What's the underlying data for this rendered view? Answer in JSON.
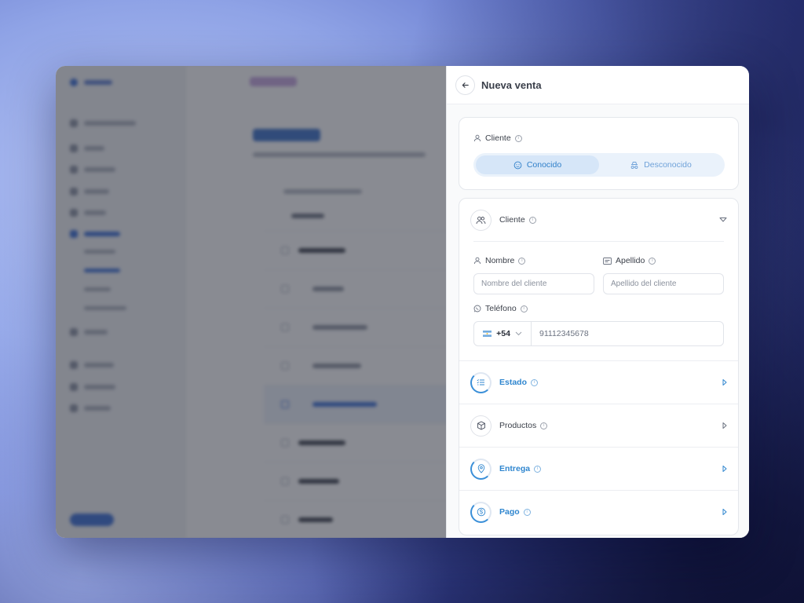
{
  "panel": {
    "title": "Nueva venta",
    "customer_type": {
      "label": "Cliente",
      "options": [
        "Conocido",
        "Desconocido"
      ],
      "selected": "Conocido"
    },
    "customer_section": {
      "title": "Cliente",
      "fields": {
        "first_name": {
          "label": "Nombre",
          "placeholder": "Nombre del cliente"
        },
        "last_name": {
          "label": "Apellido",
          "placeholder": "Apellido del cliente"
        },
        "phone": {
          "label": "Teléfono",
          "country_code": "+54",
          "placeholder": "91112345678"
        }
      }
    },
    "sections": [
      {
        "title": "Estado",
        "icon": "list-check-icon"
      },
      {
        "title": "Productos",
        "icon": "package-icon"
      },
      {
        "title": "Entrega",
        "icon": "location-pin-icon"
      },
      {
        "title": "Pago",
        "icon": "dollar-icon"
      }
    ]
  },
  "colors": {
    "accent": "#2f86cf",
    "segment_bg": "#eaf2fb",
    "segment_active": "#d6e6f8"
  }
}
